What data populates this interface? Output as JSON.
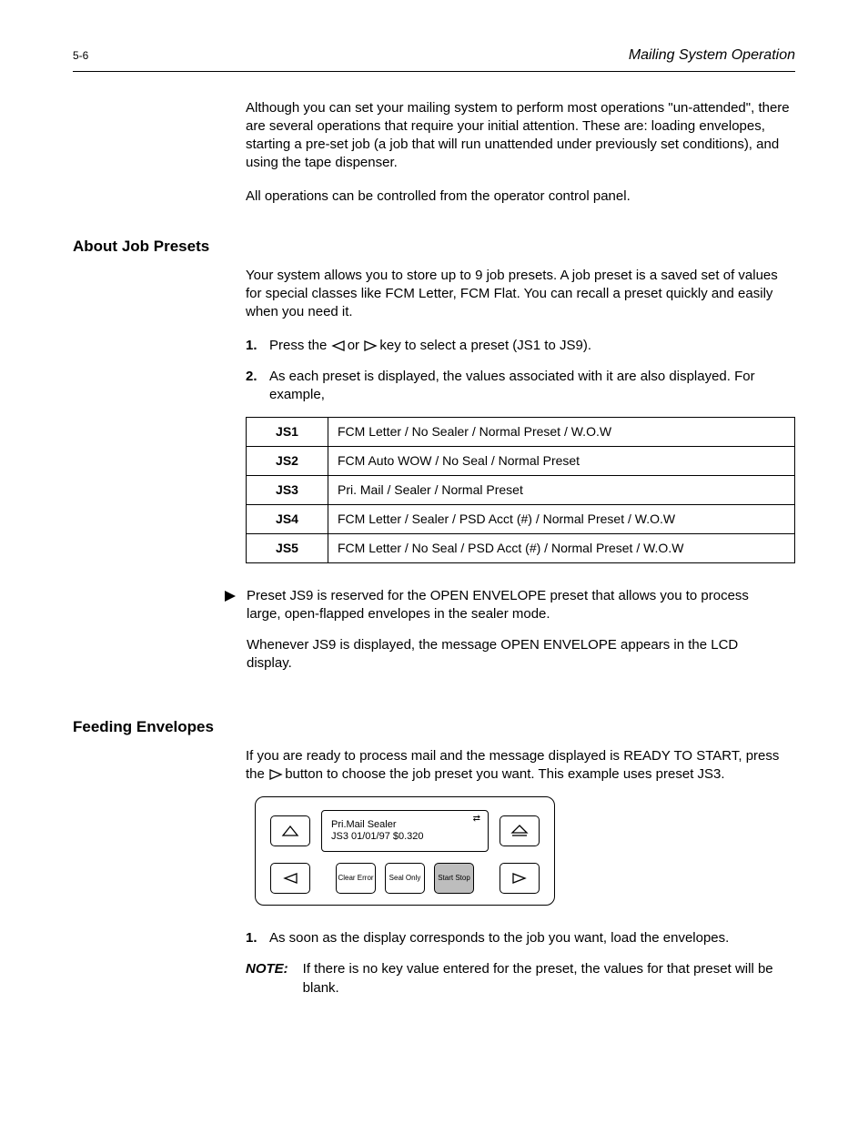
{
  "header": {
    "left": "5-6",
    "right": "Mailing System Operation"
  },
  "intro": {
    "p1": "Although you can set your mailing system to perform most operations \"un-attended\", there are several operations that require your initial attention. These are: loading envelopes, starting a pre-set job (a job that will run unattended under previously set conditions), and using the tape dispenser.",
    "p2": "All operations can be controlled from the operator control panel."
  },
  "jobsets": {
    "title": "About Job Presets",
    "p1": "Your system allows you to store up to 9 job presets. A job preset is a saved set of values for special classes like FCM Letter, FCM Flat. You can recall a preset quickly and easily when you need it.",
    "step1_num": "1.",
    "step1_text_a": "Press the ",
    "step1_text_b": " or ",
    "step1_text_c": " key to select a preset (JS1 to JS9).",
    "step2_num": "2.",
    "step2_text": "As each preset is displayed, the values associated with it are also displayed. For example,",
    "table": [
      {
        "k": "JS1",
        "v": "FCM Letter / No Sealer / Normal Preset / W.O.W"
      },
      {
        "k": "JS2",
        "v": "FCM Auto WOW / No Seal / Normal Preset"
      },
      {
        "k": "JS3",
        "v": "Pri. Mail / Sealer / Normal Preset"
      },
      {
        "k": "JS4",
        "v": "FCM Letter / Sealer / PSD Acct (#) / Normal Preset / W.O.W"
      },
      {
        "k": "JS5",
        "v": "FCM Letter / No Seal / PSD Acct (#) / Normal Preset / W.O.W"
      }
    ]
  },
  "openenv": {
    "p1": "Preset JS9 is reserved for the OPEN ENVELOPE preset that allows you to process large, open-flapped envelopes in the sealer mode.",
    "p2": "Whenever JS9 is displayed, the message OPEN ENVELOPE appears in the LCD display."
  },
  "feeding": {
    "title": "Feeding Envelopes",
    "p1_a": "If you are ready to process mail and the message displayed is READY TO START, press the ",
    "p1_b": " button to choose the job preset you want. This example uses preset JS3.",
    "panel": {
      "lcd_line1": "Pri.Mail Sealer",
      "lcd_line2": "JS3 01/01/97 $0.320",
      "btn_clear": "Clear Error",
      "btn_seal": "Seal Only",
      "btn_start": "Start Stop"
    },
    "step1_num": "1.",
    "step1_text": "As soon as the display corresponds to the job you want, load the envelopes."
  },
  "note": {
    "label": "NOTE:",
    "text": "If there is no key value entered for the preset, the values for that preset will be blank."
  }
}
